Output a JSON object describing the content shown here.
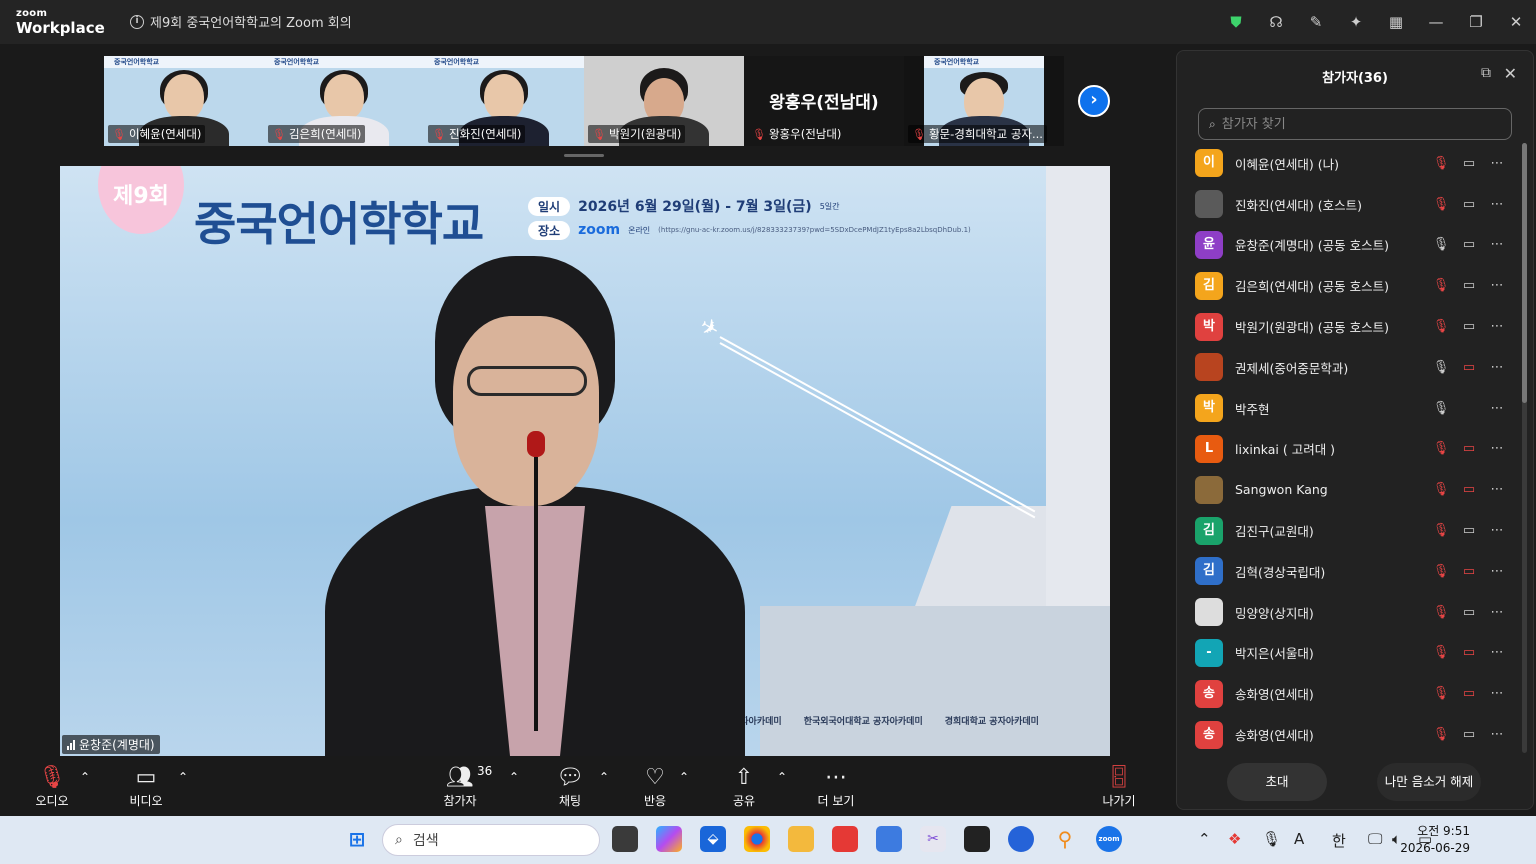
{
  "app": {
    "logo_top": "zoom",
    "logo_bottom": "Workplace",
    "window_title": "제9회 중국언어학학교의 Zoom 회의"
  },
  "gallery": {
    "tiles": [
      {
        "name": "이혜윤(연세대)",
        "banner": "중국언어학학교"
      },
      {
        "name": "김은희(연세대)",
        "banner": "중국언어학학교"
      },
      {
        "name": "진화진(연세대)",
        "banner": "중국언어학학교"
      },
      {
        "name": "박원기(원광대)"
      },
      {
        "name": "왕홍우(전남대)",
        "display_name": "왕홍우(전남대)"
      },
      {
        "name": "황문-경희대학교 공자...",
        "banner": "중국언어학학교"
      }
    ]
  },
  "stage": {
    "badge": "제9회",
    "title": "중국언어학학교",
    "date_label": "일시",
    "date_value": "2026년 6월 29일(월) - 7월 3일(금)",
    "date_suffix": "5일간",
    "place_label": "장소",
    "place_zoom": "zoom",
    "place_type": "온라인",
    "place_url": "(https://gnu-ac-kr.zoom.us/j/82833323739?pwd=5SDxDcePMdJZ1tyEps8a2LbsqDhDub.1)",
    "sponsors": [
      "공자아카데미",
      "한국외국어대학교 공자아카데미",
      "경희대학교 공자아카데미"
    ],
    "speaker_name": "윤창준(계명대)"
  },
  "toolbar": {
    "audio": "오디오",
    "video": "비디오",
    "participants": "참가자",
    "participants_count": "36",
    "chat": "채팅",
    "react": "반응",
    "share": "공유",
    "more": "더 보기",
    "leave": "나가기"
  },
  "panel": {
    "title": "참가자(36)",
    "search_placeholder": "참가자 찾기",
    "participants": [
      {
        "initial": "이",
        "color": "#f4a51c",
        "name": "이혜윤(연세대) (나)",
        "mic": "muted",
        "video": "on"
      },
      {
        "initial": "",
        "color": "#5a5a5a",
        "name": "진화진(연세대) (호스트)",
        "mic": "muted",
        "video": "on"
      },
      {
        "initial": "윤",
        "color": "#8e3ec6",
        "name": "윤창준(계명대) (공동 호스트)",
        "mic": "on",
        "video": "on"
      },
      {
        "initial": "김",
        "color": "#f4a51c",
        "name": "김은희(연세대) (공동 호스트)",
        "mic": "muted",
        "video": "on"
      },
      {
        "initial": "박",
        "color": "#e0413f",
        "name": "박원기(원광대) (공동 호스트)",
        "mic": "muted",
        "video": "on"
      },
      {
        "initial": "",
        "color": "#b8441f",
        "name": "권제세(중어중문학과)",
        "mic": "on",
        "video": "off"
      },
      {
        "initial": "박",
        "color": "#f4a51c",
        "name": "박주현",
        "mic": "on",
        "video": "none"
      },
      {
        "initial": "L",
        "color": "#e85b10",
        "name": "lixinkai ( 고려대 )",
        "mic": "muted",
        "video": "off"
      },
      {
        "initial": "",
        "color": "#8b6a3a",
        "name": "Sangwon Kang",
        "mic": "muted",
        "video": "off"
      },
      {
        "initial": "김",
        "color": "#1aa36b",
        "name": "김진구(교원대)",
        "mic": "muted",
        "video": "on"
      },
      {
        "initial": "김",
        "color": "#2f6fc9",
        "name": "김혁(경상국립대)",
        "mic": "muted",
        "video": "off"
      },
      {
        "initial": "",
        "color": "#ddd",
        "name": "밍양양(상지대)",
        "mic": "muted",
        "video": "on"
      },
      {
        "initial": "-",
        "color": "#12a5b5",
        "name": "박지은(서울대)",
        "mic": "muted",
        "video": "off"
      },
      {
        "initial": "송",
        "color": "#e0413f",
        "name": "송화영(연세대)",
        "mic": "muted",
        "video": "off"
      },
      {
        "initial": "송",
        "color": "#e0413f",
        "name": "송화영(연세대)",
        "mic": "muted",
        "video": "on"
      }
    ],
    "invite": "초대",
    "unmute_me": "나만 음소거 해제"
  },
  "taskbar": {
    "search": "검색",
    "ime": "한",
    "time": "오전 9:51",
    "date": "2026-06-29"
  }
}
